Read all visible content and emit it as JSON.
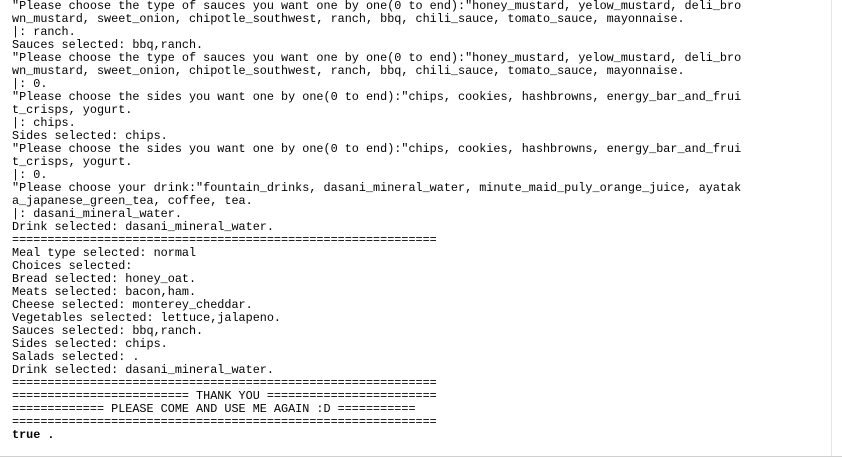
{
  "console": {
    "lines": [
      "\"Please choose the type of sauces you want one by one(0 to end):\"honey_mustard, yelow_mustard, deli_bro",
      "wn_mustard, sweet_onion, chipotle_southwest, ranch, bbq, chili_sauce, tomato_sauce, mayonnaise.",
      "|: ranch.",
      "Sauces selected: bbq,ranch.",
      "\"Please choose the type of sauces you want one by one(0 to end):\"honey_mustard, yelow_mustard, deli_bro",
      "wn_mustard, sweet_onion, chipotle_southwest, ranch, bbq, chili_sauce, tomato_sauce, mayonnaise.",
      "|: 0.",
      "\"Please choose the sides you want one by one(0 to end):\"chips, cookies, hashbrowns, energy_bar_and_frui",
      "t_crisps, yogurt.",
      "|: chips.",
      "Sides selected: chips.",
      "\"Please choose the sides you want one by one(0 to end):\"chips, cookies, hashbrowns, energy_bar_and_frui",
      "t_crisps, yogurt.",
      "|: 0.",
      "\"Please choose your drink:\"fountain_drinks, dasani_mineral_water, minute_maid_puly_orange_juice, ayatak",
      "a_japanese_green_tea, coffee, tea.",
      "|: dasani_mineral_water.",
      "Drink selected: dasani_mineral_water.",
      "============================================================",
      "Meal type selected: normal",
      "Choices selected:",
      "Bread selected: honey_oat.",
      "Meats selected: bacon,ham.",
      "Cheese selected: monterey_cheddar.",
      "Vegetables selected: lettuce,jalapeno.",
      "Sauces selected: bbq,ranch.",
      "Sides selected: chips.",
      "Salads selected: .",
      "Drink selected: dasani_mineral_water.",
      "============================================================",
      "========================= THANK YOU ========================",
      "============= PLEASE COME AND USE ME AGAIN :D ===========",
      "============================================================"
    ],
    "result": "true ."
  }
}
